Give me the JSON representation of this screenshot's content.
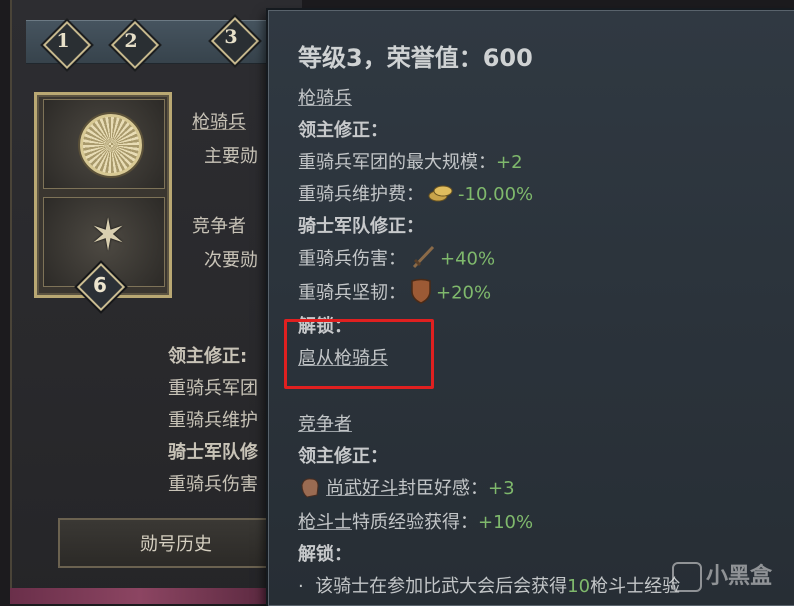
{
  "ranks": [
    "1",
    "2",
    "3"
  ],
  "card": {
    "level": "6",
    "entries": [
      {
        "name": "枪骑兵",
        "sub": "主要勋"
      },
      {
        "name": "竞争者",
        "sub": "次要勋"
      }
    ]
  },
  "left_modifiers": {
    "lord_header": "领主修正:",
    "lines": [
      "重骑兵军团",
      "重骑兵维护"
    ],
    "knight_header": "骑士军队修",
    "knight_lines": [
      "重骑兵伤害"
    ]
  },
  "history_button": "勋号历史",
  "tooltip": {
    "title": "等级3，荣誉值：600",
    "section1": {
      "name": "枪骑兵",
      "lord_header": "领主修正：",
      "lord_line1": {
        "label": "重骑兵军团的最大规模：",
        "value": "+2"
      },
      "lord_line2": {
        "label": "重骑兵维护费：",
        "value": "-10.00%",
        "icon": "gold-coins-icon"
      },
      "knight_header": "骑士军队修正：",
      "knight_line1": {
        "label": "重骑兵伤害：",
        "value": "+40%",
        "icon": "sword-icon"
      },
      "knight_line2": {
        "label": "重骑兵坚韧：",
        "value": "+20%",
        "icon": "shield-icon"
      },
      "unlock_header": "解锁：",
      "unlock_item": "扈从枪骑兵"
    },
    "section2": {
      "name": "竞争者",
      "lord_header": "领主修正：",
      "line1": {
        "link": "尚武好斗",
        "label": "封臣好感：",
        "value": "+3",
        "icon": "fist-icon"
      },
      "line2": {
        "link": "枪斗士",
        "label": "特质经验获得：",
        "value": "+10%"
      },
      "unlock_header": "解锁：",
      "unlock_item_prefix": "该骑士在参加比武大会后会获得",
      "unlock_item_value": "10",
      "unlock_item_suffix": "枪斗士经验"
    }
  },
  "watermark": "小黑盒",
  "colors": {
    "positive": "#7fb96c",
    "highlight": "#e02020",
    "tooltip_bg": "#2d353d"
  }
}
